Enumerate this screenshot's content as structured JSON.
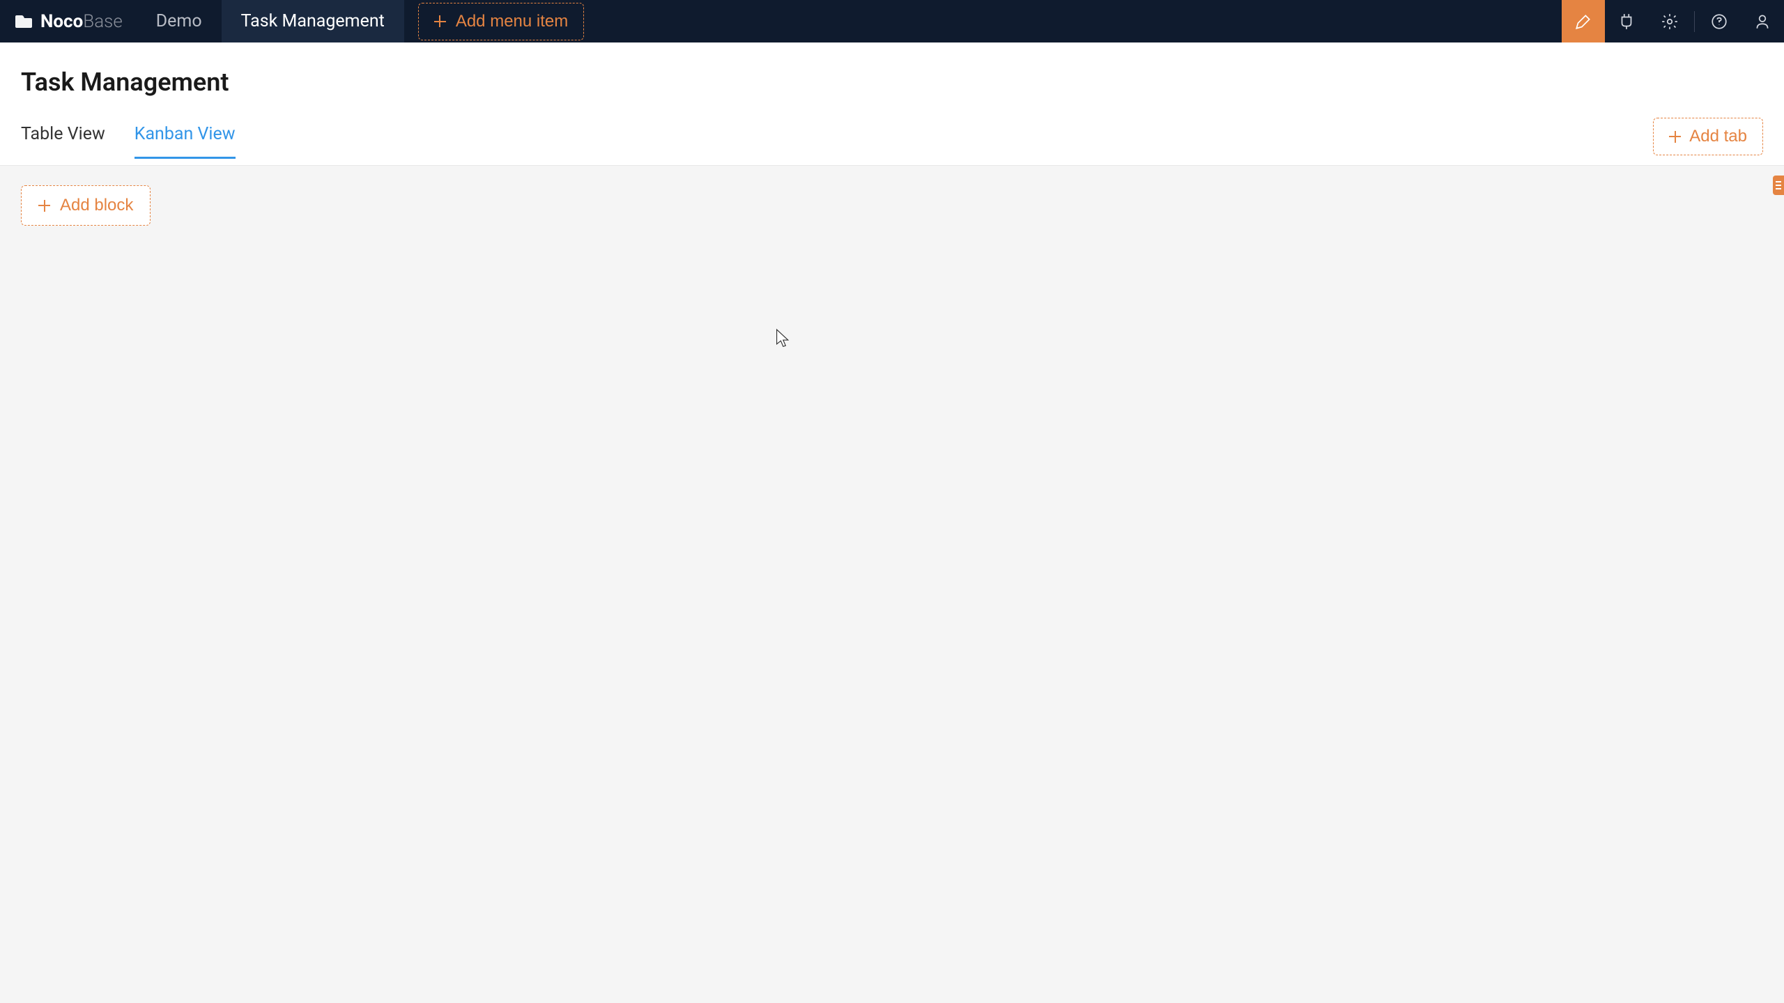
{
  "logo": {
    "bold": "Noco",
    "light": "Base"
  },
  "nav": {
    "items": [
      {
        "label": "Demo",
        "active": false
      },
      {
        "label": "Task Management",
        "active": true
      }
    ],
    "add_menu_label": "Add menu item"
  },
  "page": {
    "title": "Task Management",
    "tabs": [
      {
        "label": "Table View",
        "active": false
      },
      {
        "label": "Kanban View",
        "active": true
      }
    ],
    "add_tab_label": "Add tab",
    "add_block_label": "Add block"
  }
}
